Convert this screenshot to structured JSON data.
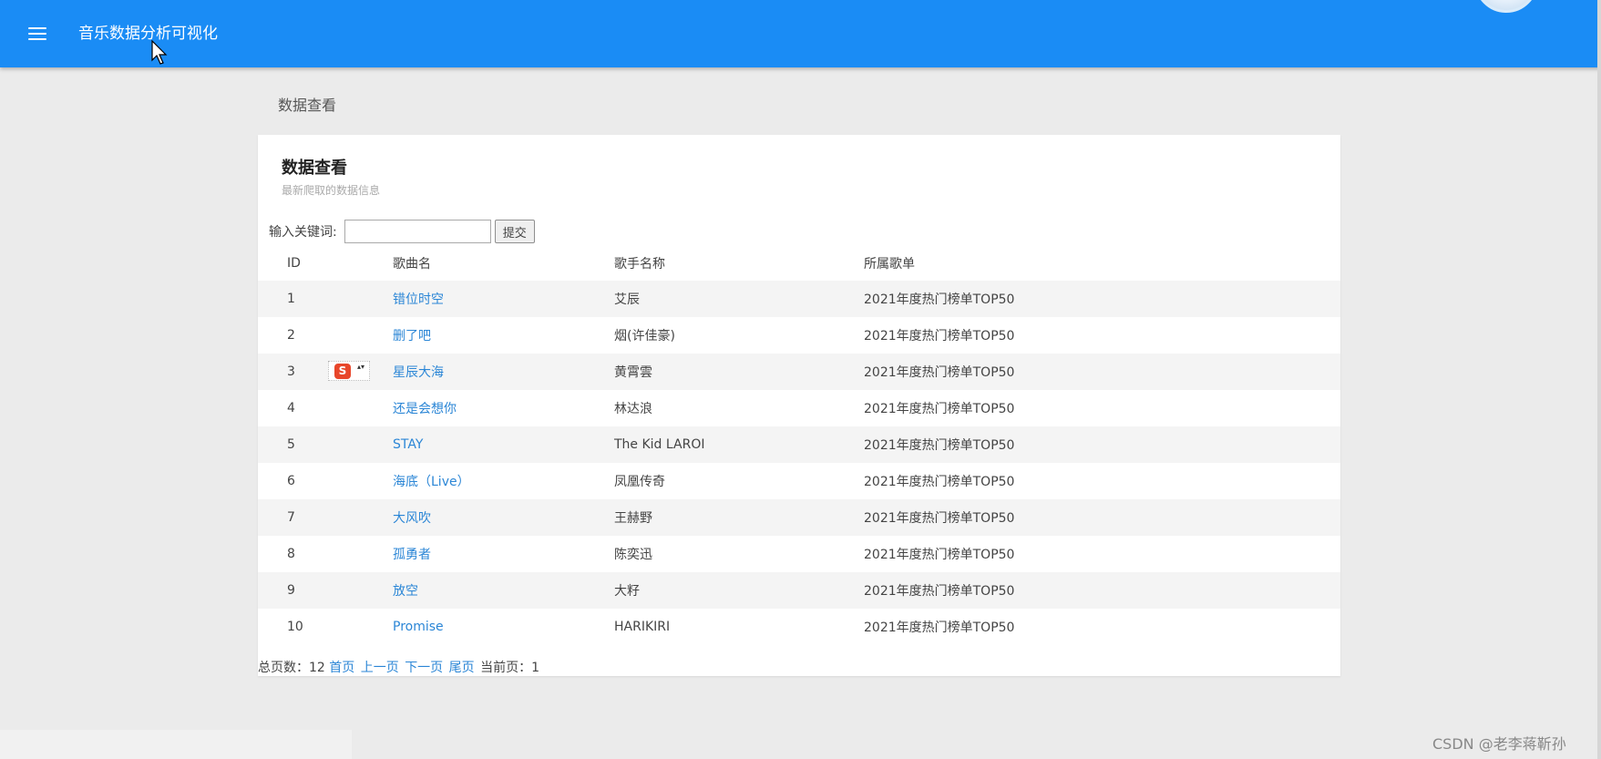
{
  "theme": {
    "primary": "#1a8cf5",
    "link": "#2b86d6",
    "background": "#ebebeb"
  },
  "header": {
    "title": "音乐数据分析可视化",
    "menu_icon": "hamburger-menu-icon"
  },
  "breadcrumb": "数据查看",
  "card": {
    "title": "数据查看",
    "subtitle": "最新爬取的数据信息"
  },
  "search": {
    "label": "输入关键词:",
    "value": "",
    "submit_label": "提交"
  },
  "table": {
    "headers": [
      "ID",
      "歌曲名",
      "歌手名称",
      "所属歌单"
    ],
    "rows": [
      {
        "id": "1",
        "song": "错位时空",
        "artist": "艾辰",
        "playlist": "2021年度热门榜单TOP50"
      },
      {
        "id": "2",
        "song": "删了吧",
        "artist": "烟(许佳豪)",
        "playlist": "2021年度热门榜单TOP50"
      },
      {
        "id": "3",
        "song": "星辰大海",
        "artist": "黄霄雲",
        "playlist": "2021年度热门榜单TOP50"
      },
      {
        "id": "4",
        "song": "还是会想你",
        "artist": "林达浪",
        "playlist": "2021年度热门榜单TOP50"
      },
      {
        "id": "5",
        "song": "STAY",
        "artist": "The Kid LAROI",
        "playlist": "2021年度热门榜单TOP50"
      },
      {
        "id": "6",
        "song": "海底（Live）",
        "artist": "凤凰传奇",
        "playlist": "2021年度热门榜单TOP50"
      },
      {
        "id": "7",
        "song": "大风吹",
        "artist": "王赫野",
        "playlist": "2021年度热门榜单TOP50"
      },
      {
        "id": "8",
        "song": "孤勇者",
        "artist": "陈奕迅",
        "playlist": "2021年度热门榜单TOP50"
      },
      {
        "id": "9",
        "song": "放空",
        "artist": "大籽",
        "playlist": "2021年度热门榜单TOP50"
      },
      {
        "id": "10",
        "song": "Promise",
        "artist": "HARIKIRI",
        "playlist": "2021年度热门榜单TOP50"
      }
    ]
  },
  "ime_badge": {
    "logo_text": "S",
    "arrows": "▴▾"
  },
  "pagination": {
    "total_label": "总页数：",
    "total": "12",
    "first": "首页",
    "prev": "上一页",
    "next": "下一页",
    "last": "尾页",
    "current_label": "当前页：",
    "current": "1"
  },
  "watermark": "CSDN @老李蒋靳孙"
}
